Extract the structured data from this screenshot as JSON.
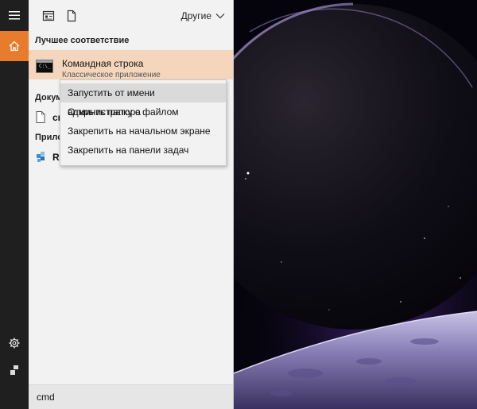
{
  "rail": {
    "menu_icon": "hamburger-icon",
    "home_icon": "home-icon",
    "settings_icon": "gear-icon",
    "user_icon": "user-icon"
  },
  "toolbar": {
    "apps_icon": "apps-icon",
    "docs_icon": "document-icon",
    "other_label": "Другие"
  },
  "best_match": {
    "heading": "Лучшее соответствие",
    "title": "Командная строка",
    "subtitle": "Классическое приложение",
    "icon": "cmd-icon"
  },
  "documents": {
    "heading": "Докум",
    "item": "cm"
  },
  "apps": {
    "heading": "Прило",
    "item": "RE"
  },
  "context_menu": {
    "items": [
      "Запустить от имени администратора",
      "Открыть папку с файлом",
      "Закрепить на начальном экране",
      "Закрепить на панели задач"
    ]
  },
  "search": {
    "value": "cmd"
  },
  "colors": {
    "accent": "#e87b2c",
    "highlight": "#f5d6bc",
    "rail": "#1f1f1f",
    "panel": "#f2f2f2"
  }
}
